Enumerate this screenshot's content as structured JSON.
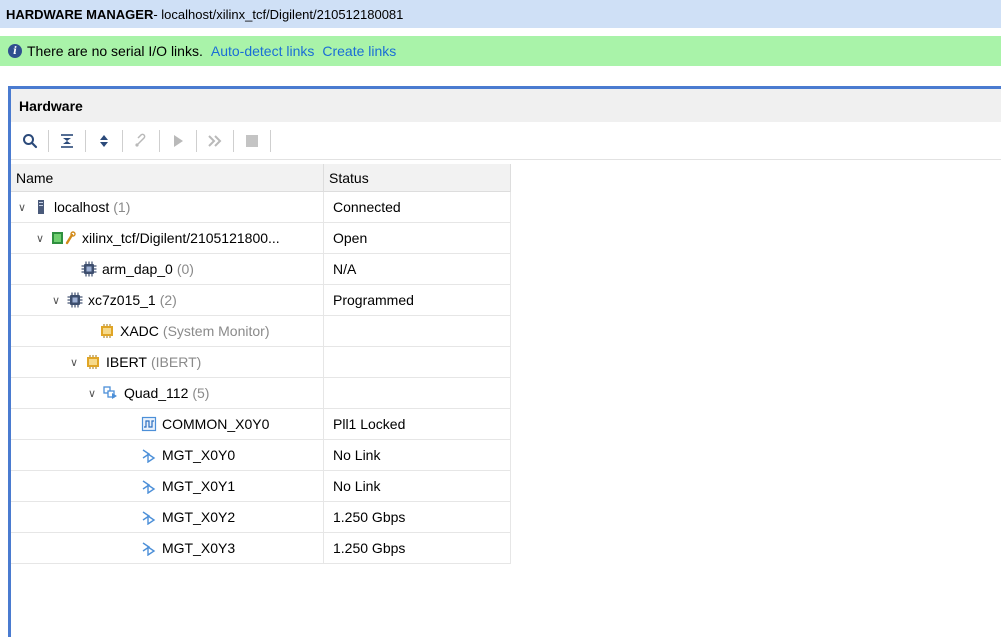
{
  "titlebar": {
    "prefix": "HARDWARE MANAGER",
    "path": " - localhost/xilinx_tcf/Digilent/210512180081"
  },
  "infobar": {
    "message": "There are no serial I/O links.",
    "link_autodetect": "Auto-detect links",
    "link_create": "Create links"
  },
  "panel": {
    "title": "Hardware",
    "columns": {
      "name": "Name",
      "status": "Status"
    }
  },
  "toolbar": {
    "icons": [
      "search-icon",
      "collapse-all-icon",
      "expand-all-icon",
      "auto-connect-icon",
      "run-icon",
      "run-all-icon",
      "stop-icon"
    ]
  },
  "rows": [
    {
      "label": "localhost",
      "count": "(1)",
      "status": "Connected",
      "icon": "server-icon",
      "expanded": true
    },
    {
      "label": "xilinx_tcf/Digilent/2105121800...",
      "count": "",
      "status": "Open",
      "icon": "target-icon",
      "expanded": true
    },
    {
      "label": "arm_dap_0",
      "count": "(0)",
      "status": "N/A",
      "icon": "chip-icon",
      "expanded": false
    },
    {
      "label": "xc7z015_1",
      "count": "(2)",
      "status": "Programmed",
      "icon": "chip-icon",
      "expanded": true
    },
    {
      "label": "XADC",
      "count": "(System Monitor)",
      "status": "",
      "icon": "debug-core-icon",
      "expanded": false
    },
    {
      "label": "IBERT",
      "count": "(IBERT)",
      "status": "",
      "icon": "debug-core-icon",
      "expanded": true
    },
    {
      "label": "Quad_112",
      "count": "(5)",
      "status": "",
      "icon": "quad-icon",
      "expanded": true
    },
    {
      "label": "COMMON_X0Y0",
      "count": "",
      "status": "Pll1 Locked",
      "icon": "common-icon",
      "expanded": false
    },
    {
      "label": "MGT_X0Y0",
      "count": "",
      "status": "No Link",
      "icon": "mgt-icon",
      "expanded": false
    },
    {
      "label": "MGT_X0Y1",
      "count": "",
      "status": "No Link",
      "icon": "mgt-icon",
      "expanded": false
    },
    {
      "label": "MGT_X0Y2",
      "count": "",
      "status": "1.250 Gbps",
      "icon": "mgt-icon",
      "expanded": false
    },
    {
      "label": "MGT_X0Y3",
      "count": "",
      "status": "1.250 Gbps",
      "icon": "mgt-icon",
      "expanded": false
    }
  ],
  "colors": {
    "titlebar_bg": "#cfe0f6",
    "infobar_bg": "#a9f3a9",
    "link": "#1a6dd6",
    "panel_accent": "#4a7bd0"
  }
}
